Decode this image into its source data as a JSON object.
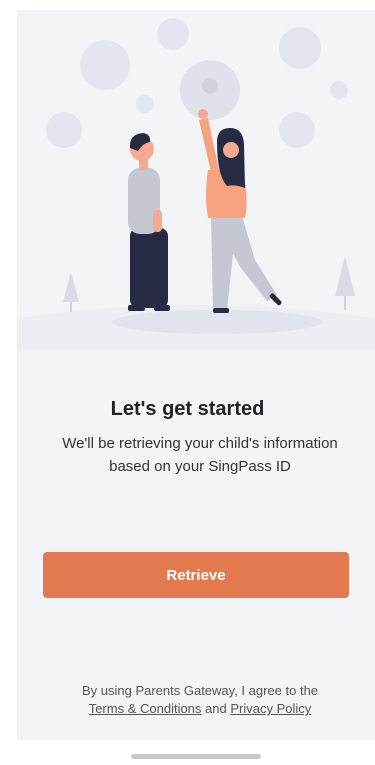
{
  "onboarding": {
    "title": "Let's get started",
    "subtitle": "We'll be retrieving your child's information based on your SingPass ID",
    "retrieve_label": "Retrieve"
  },
  "legal": {
    "prefix": "By using Parents Gateway, I agree to the",
    "terms_label": "Terms & Conditions",
    "conjunction": "and",
    "privacy_label": "Privacy Policy"
  },
  "colors": {
    "accent": "#e4794f",
    "background": "#f3f4f8"
  },
  "illustration": {
    "subject": "two-people-reaching-bubbles"
  }
}
